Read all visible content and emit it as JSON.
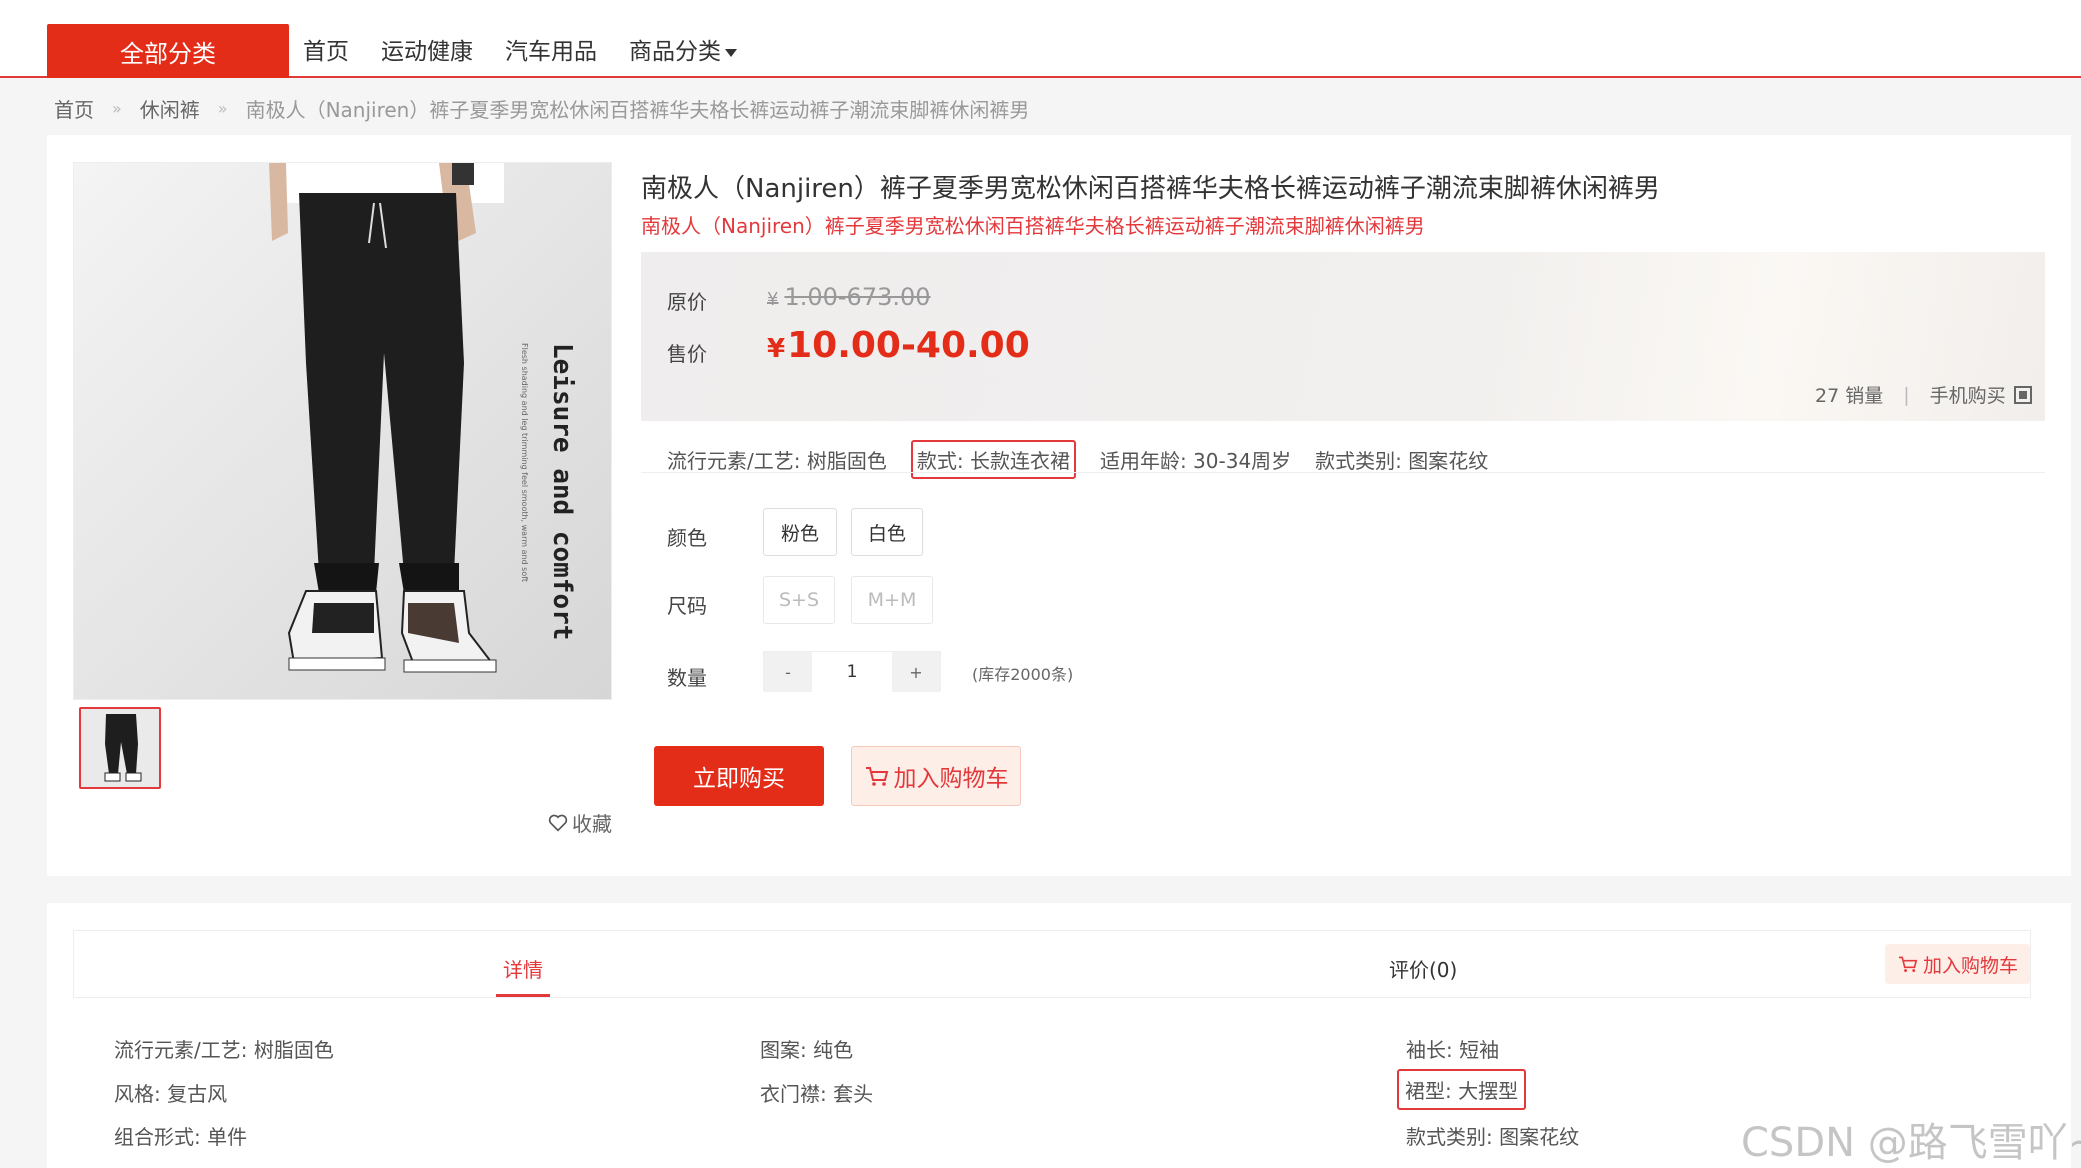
{
  "nav": {
    "all_categories": "全部分类",
    "links": [
      "首页",
      "运动健康",
      "汽车用品",
      "商品分类"
    ]
  },
  "breadcrumb": {
    "items": [
      "首页",
      "休闲裤",
      "南极人（Nanjiren）裤子夏季男宽松休闲百搭裤华夫格长裤运动裤子潮流束脚裤休闲裤男"
    ],
    "separator": "»"
  },
  "product": {
    "image_text": "Leisure and comfort",
    "image_subtext": "Flesh shading and leg trimming feel smooth, warm and soft",
    "title": "南极人（Nanjiren）裤子夏季男宽松休闲百搭裤华夫格长裤运动裤子潮流束脚裤休闲裤男",
    "subtitle": "南极人（Nanjiren）裤子夏季男宽松休闲百搭裤华夫格长裤运动裤子潮流束脚裤休闲裤男",
    "favorite_label": "收藏"
  },
  "price": {
    "original_label": "原价",
    "currency": "¥",
    "original_value": "1.00-673.00",
    "sale_label": "售价",
    "sale_value": "10.00-40.00",
    "sales_count": "27 销量",
    "mobile_buy": "手机购买"
  },
  "attributes": [
    {
      "text": "流行元素/工艺: 树脂固色",
      "highlighted": false
    },
    {
      "text": "款式: 长款连衣裙",
      "highlighted": true
    },
    {
      "text": "适用年龄: 30-34周岁",
      "highlighted": false
    },
    {
      "text": "款式类别: 图案花纹",
      "highlighted": false
    }
  ],
  "options": {
    "color_label": "颜色",
    "colors": [
      "粉色",
      "白色"
    ],
    "size_label": "尺码",
    "sizes": [
      "S+S",
      "M+M"
    ],
    "qty_label": "数量",
    "qty_minus": "-",
    "qty_value": "1",
    "qty_plus": "+",
    "stock": "(库存2000条)"
  },
  "actions": {
    "buy_now": "立即购买",
    "add_to_cart": "加入购物车"
  },
  "detail_tabs": {
    "detail": "详情",
    "reviews": "评价(0)",
    "add_to_cart": "加入购物车"
  },
  "specs": {
    "col1": [
      "流行元素/工艺: 树脂固色",
      "风格: 复古风",
      "组合形式: 单件"
    ],
    "col2": [
      "图案: 纯色",
      "衣门襟: 套头"
    ],
    "col3": [
      "袖长: 短袖",
      "裙型: 大摆型",
      "款式类别: 图案花纹"
    ]
  },
  "watermark": "CSDN @路飞雪吖~",
  "colors": {
    "accent": "#e42d18",
    "accent_light": "#fdeee8"
  }
}
